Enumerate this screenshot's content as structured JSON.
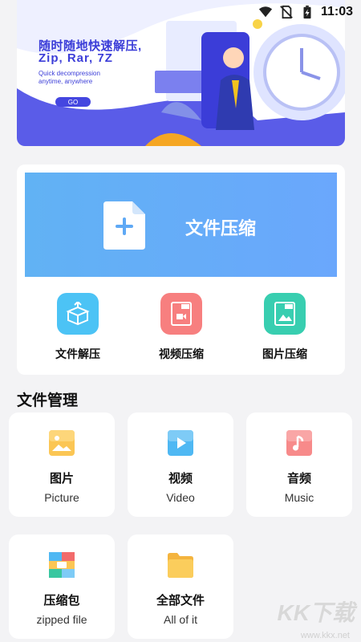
{
  "status_bar": {
    "time": "11:03",
    "icons": [
      "wifi-icon",
      "no-sim-icon",
      "battery-charging-icon"
    ]
  },
  "banner": {
    "title": "随时随地快速解压,",
    "formats": "Zip, Rar, 7Z",
    "en_line1": "Quick decompression",
    "en_line2": "anytime, anywhere",
    "go_label": "GO"
  },
  "compress": {
    "label": "文件压缩"
  },
  "tools": [
    {
      "label": "文件解压",
      "icon": "box-open-icon",
      "color": "#4cc3f5"
    },
    {
      "label": "视频压缩",
      "icon": "video-zip-icon",
      "color": "#f77f7f"
    },
    {
      "label": "图片压缩",
      "icon": "image-zip-icon",
      "color": "#38ceb0"
    }
  ],
  "section": {
    "title": "文件管理"
  },
  "tiles": [
    {
      "zh": "图片",
      "en": "Picture",
      "icon": "picture-icon"
    },
    {
      "zh": "视频",
      "en": "Video",
      "icon": "video-icon"
    },
    {
      "zh": "音频",
      "en": "Music",
      "icon": "music-icon"
    },
    {
      "zh": "压缩包",
      "en": "zipped file",
      "icon": "archive-icon"
    },
    {
      "zh": "全部文件",
      "en": "All of it",
      "icon": "folder-icon"
    }
  ],
  "watermark": {
    "brand": "KK下载",
    "url": "www.kkx.net"
  }
}
